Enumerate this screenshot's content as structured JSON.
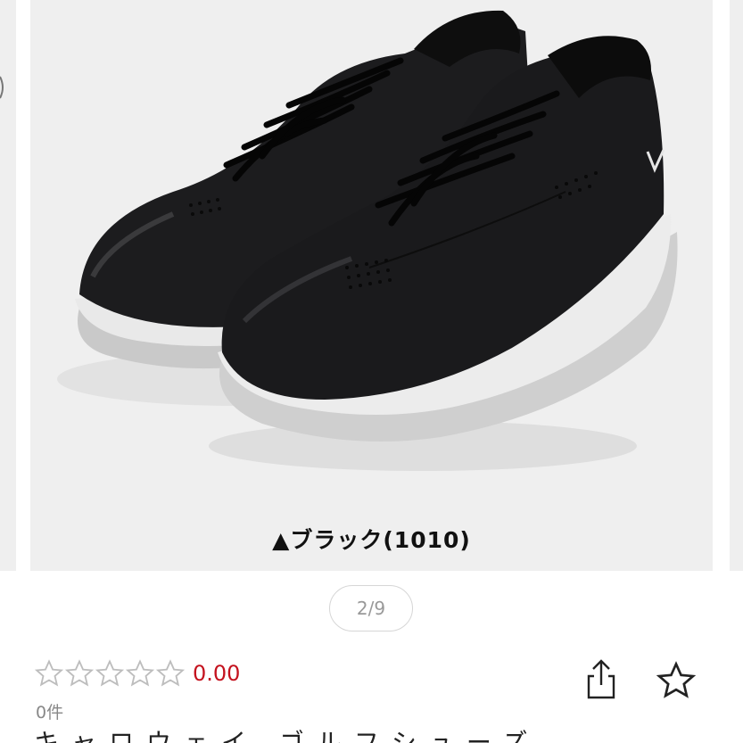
{
  "gallery": {
    "caption": "▲ブラック(1010)",
    "pager": "2/9",
    "image_icon": "shoe-photo"
  },
  "product": {
    "rating": "0.00",
    "stars_filled": 0,
    "stars_total": 5,
    "review_count": "0件",
    "title_partial": "キャロウェイ ゴルフシューズ"
  },
  "actions": {
    "share_icon": "share-icon",
    "favorite_icon": "star-outline-icon"
  },
  "colors": {
    "rating": "#c4121e",
    "slide_bg": "#efefef"
  }
}
